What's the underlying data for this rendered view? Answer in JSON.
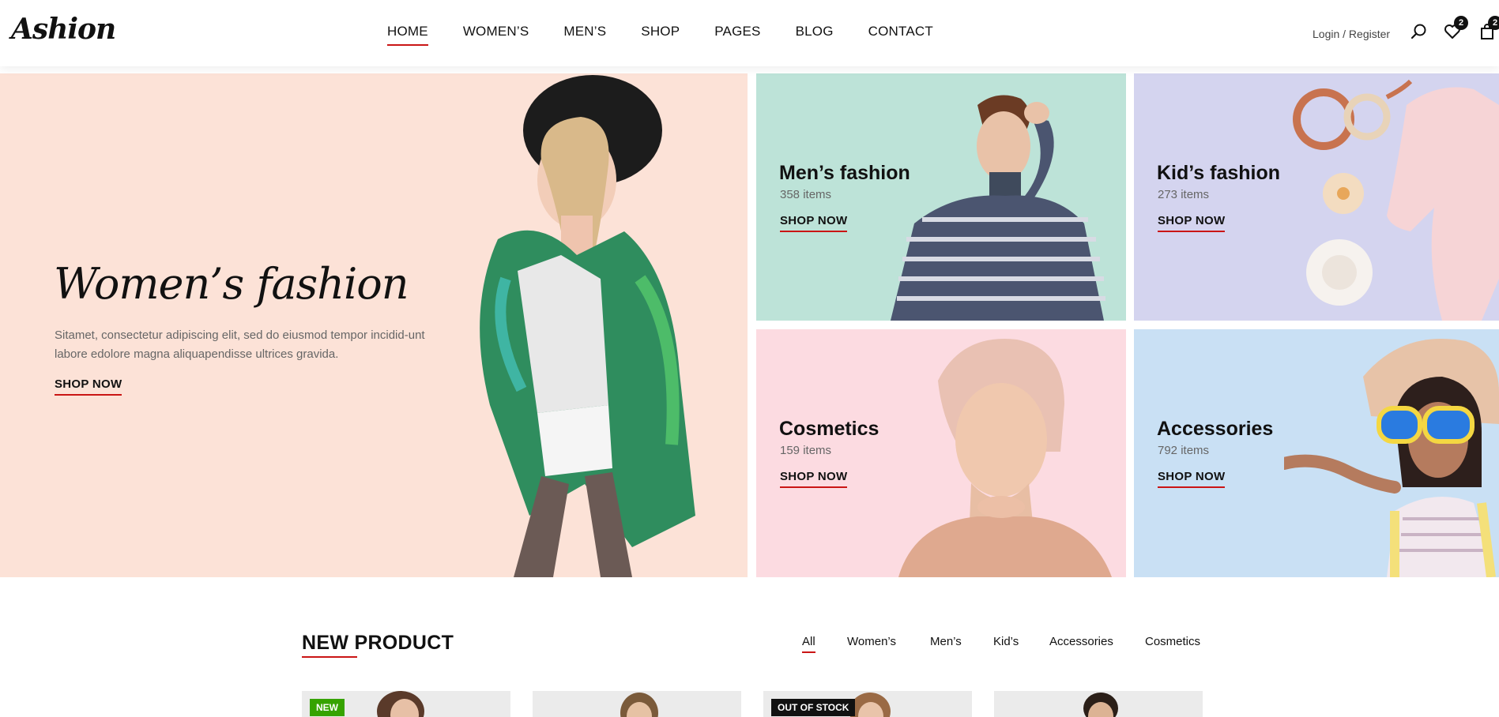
{
  "header": {
    "logo": "Ashion",
    "nav": [
      "HOME",
      "WOMEN’S",
      "MEN’S",
      "SHOP",
      "PAGES",
      "BLOG",
      "CONTACT"
    ],
    "login": "Login / Register",
    "wishlist_count": "2",
    "cart_count": "2"
  },
  "hero": {
    "main": {
      "title": "Women’s fashion",
      "description": "Sitamet, consectetur adipiscing elit, sed do eiusmod tempor incidid-unt labore edolore magna aliquapendisse ultrices gravida.",
      "cta": "SHOP NOW"
    },
    "tiles": [
      {
        "title": "Men’s fashion",
        "count": "358 items",
        "cta": "SHOP NOW"
      },
      {
        "title": "Kid’s fashion",
        "count": "273 items",
        "cta": "SHOP NOW"
      },
      {
        "title": "Cosmetics",
        "count": "159 items",
        "cta": "SHOP NOW"
      },
      {
        "title": "Accessories",
        "count": "792 items",
        "cta": "SHOP NOW"
      }
    ]
  },
  "new_product": {
    "title": "NEW PRODUCT",
    "filters": [
      "All",
      "Women’s",
      "Men’s",
      "Kid’s",
      "Accessories",
      "Cosmetics"
    ],
    "cards": [
      {
        "tag": "NEW"
      },
      {
        "tag": ""
      },
      {
        "tag": "OUT OF STOCK"
      },
      {
        "tag": ""
      }
    ]
  },
  "colors": {
    "accent": "#ca1515",
    "women_bg": "#fce2d7",
    "men_bg": "#bde3d8",
    "kid_bg": "#d4d4ef",
    "cosmetics_bg": "#fcdbe1",
    "accessories_bg": "#c9e0f4",
    "new_tag": "#36a300",
    "out_of_stock_tag": "#111111"
  }
}
